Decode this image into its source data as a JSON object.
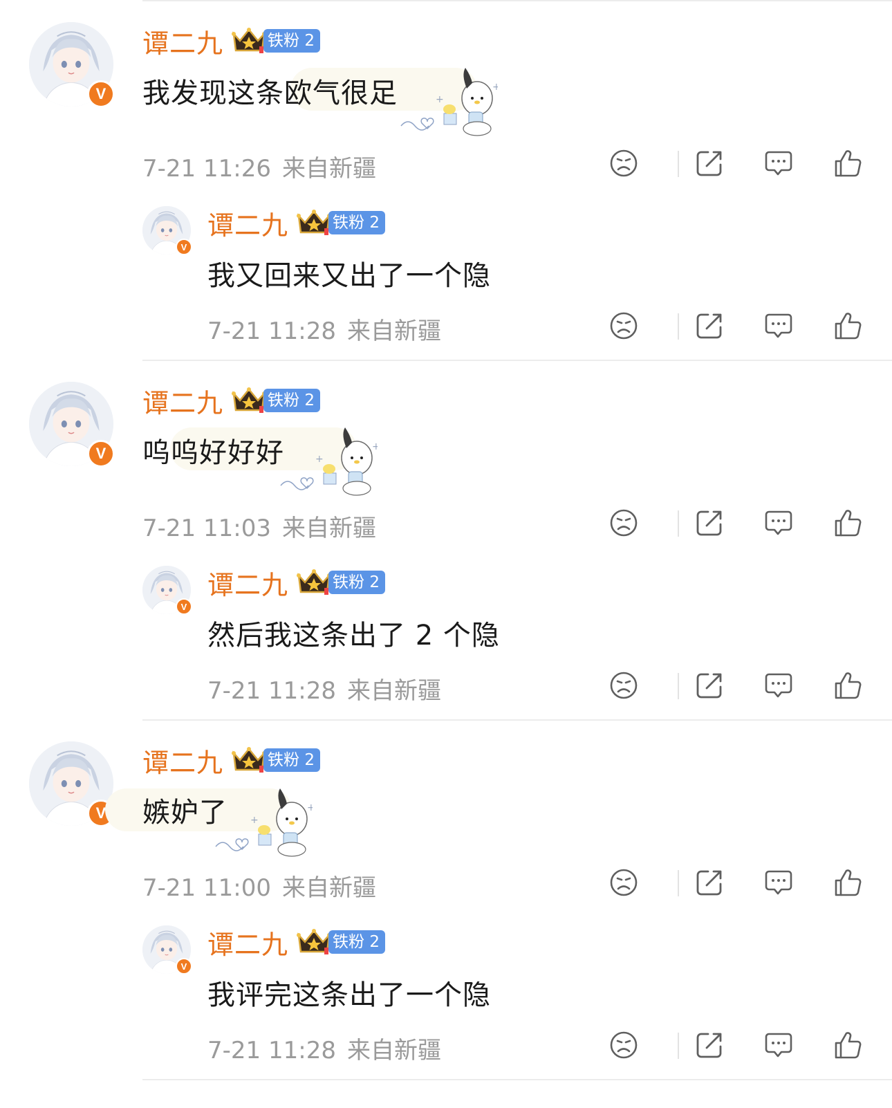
{
  "threads": [
    {
      "comment": {
        "username": "谭二九",
        "fan_badge": "铁粉 2",
        "verified_mark": "V",
        "text": "我发现这条欧气很足",
        "time": "7-21 11:26",
        "location": "来自新疆"
      },
      "reply": {
        "username": "谭二九",
        "fan_badge": "铁粉 2",
        "verified_mark": "V",
        "text": "我又回来又出了一个隐",
        "time": "7-21 11:28",
        "location": "来自新疆"
      }
    },
    {
      "comment": {
        "username": "谭二九",
        "fan_badge": "铁粉 2",
        "verified_mark": "V",
        "text": "呜呜好好好",
        "time": "7-21 11:03",
        "location": "来自新疆"
      },
      "reply": {
        "username": "谭二九",
        "fan_badge": "铁粉 2",
        "verified_mark": "V",
        "text": "然后我这条出了 2 个隐",
        "time": "7-21 11:28",
        "location": "来自新疆"
      }
    },
    {
      "comment": {
        "username": "谭二九",
        "fan_badge": "铁粉 2",
        "verified_mark": "V",
        "text": "嫉妒了",
        "time": "7-21 11:00",
        "location": "来自新疆"
      },
      "reply": {
        "username": "谭二九",
        "fan_badge": "铁粉 2",
        "verified_mark": "V",
        "text": "我评完这条出了一个隐",
        "time": "7-21 11:28",
        "location": "来自新疆"
      }
    }
  ],
  "icons": {
    "dislike": "sad-face-icon",
    "share": "share-icon",
    "comment": "comment-icon",
    "like": "thumbs-up-icon"
  },
  "colors": {
    "username": "#e6731e",
    "verified_badge": "#f07a1f",
    "fan_badge": "#5b94e6",
    "meta_text": "#9a9a9a"
  }
}
